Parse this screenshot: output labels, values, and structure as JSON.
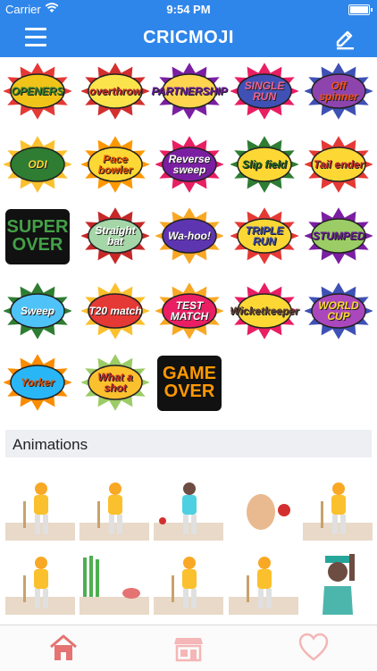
{
  "status": {
    "carrier": "Carrier",
    "time": "9:54 PM",
    "battery_level": 1.0
  },
  "nav": {
    "title": "CRICMOJI",
    "left_icon": "hamburger-menu-icon",
    "right_icon": "pencil-edit-icon"
  },
  "stickers": [
    {
      "text": "OPENERS",
      "bg": "#f0c419",
      "burst": "#e53935",
      "color": "#2e7d32"
    },
    {
      "text": "overthrow",
      "bg": "#fbe34b",
      "burst": "#d32f2f",
      "color": "#c62828"
    },
    {
      "text": "PARTNERSHIP",
      "bg": "#ffd54f",
      "burst": "#7b1fa2",
      "color": "#6a1b9a"
    },
    {
      "text": "SINGLE RUN",
      "bg": "#3f51b5",
      "burst": "#e91e63",
      "color": "#f06292"
    },
    {
      "text": "Off spinner",
      "bg": "#8e44ad",
      "burst": "#3f51b5",
      "color": "#f4511e"
    },
    {
      "text": "ODI",
      "bg": "#2e7d32",
      "burst": "#fbc02d",
      "color": "#fdd835"
    },
    {
      "text": "Pace bowler",
      "bg": "#fdd835",
      "burst": "#ff9800",
      "color": "#e65100"
    },
    {
      "text": "Reverse sweep",
      "bg": "#7b1fa2",
      "burst": "#e91e63",
      "color": "#ffffff"
    },
    {
      "text": "Slip field",
      "bg": "#fdd835",
      "burst": "#2e7d32",
      "color": "#1b5e20"
    },
    {
      "text": "Tail ender",
      "bg": "#fdd835",
      "burst": "#e53935",
      "color": "#c62828"
    },
    {
      "text": "SUPER OVER",
      "bg": "#111111",
      "burst": "#2e7d32",
      "color": "#43a047"
    },
    {
      "text": "Straight bat",
      "bg": "#a5d6a7",
      "burst": "#c62828",
      "color": "#ffffff"
    },
    {
      "text": "Wa-hoo!",
      "bg": "#5e35b1",
      "burst": "#f9a825",
      "color": "#ffffff"
    },
    {
      "text": "TRIPLE RUN",
      "bg": "#fdd835",
      "burst": "#e53935",
      "color": "#3949ab"
    },
    {
      "text": "STUMPED",
      "bg": "#9ccc65",
      "burst": "#7b1fa2",
      "color": "#6a1b9a"
    },
    {
      "text": "Sweep",
      "bg": "#4fc3f7",
      "burst": "#2e7d32",
      "color": "#ffffff"
    },
    {
      "text": "T20 match",
      "bg": "#e53935",
      "burst": "#fbc02d",
      "color": "#ffffff"
    },
    {
      "text": "TEST MATCH",
      "bg": "#e91e63",
      "burst": "#f9a825",
      "color": "#ffffff"
    },
    {
      "text": "Wicketkeeper",
      "bg": "#fdd835",
      "burst": "#e91e63",
      "color": "#5d4037"
    },
    {
      "text": "WORLD CUP",
      "bg": "#ab47bc",
      "burst": "#3f51b5",
      "color": "#fdd835"
    },
    {
      "text": "Yorker",
      "bg": "#29b6f6",
      "burst": "#fb8c00",
      "color": "#e65100"
    },
    {
      "text": "What a shot",
      "bg": "#fbc02d",
      "burst": "#9ccc65",
      "color": "#c62828"
    },
    {
      "text": "GAME OVER",
      "bg": "#111111",
      "burst": "#fb8c00",
      "color": "#ff9800"
    }
  ],
  "animations_section": {
    "title": "Animations"
  },
  "animations": [
    {
      "name": "batsman-bowled-animation"
    },
    {
      "name": "batsman-defence-animation"
    },
    {
      "name": "fielder-catch-animation"
    },
    {
      "name": "egg-and-ball-animation"
    },
    {
      "name": "batsman-drive-animation"
    },
    {
      "name": "batsman-stance-animation"
    },
    {
      "name": "stumps-broken-animation"
    },
    {
      "name": "batsman-raised-bat-animation"
    },
    {
      "name": "batsman-backfoot-animation"
    },
    {
      "name": "umpire-signal-animation"
    }
  ],
  "tabs": [
    {
      "icon": "home-icon",
      "color": "#e57373"
    },
    {
      "icon": "store-icon",
      "color": "#f4b6b6"
    },
    {
      "icon": "heart-icon",
      "color": "#f4b6b6"
    }
  ]
}
